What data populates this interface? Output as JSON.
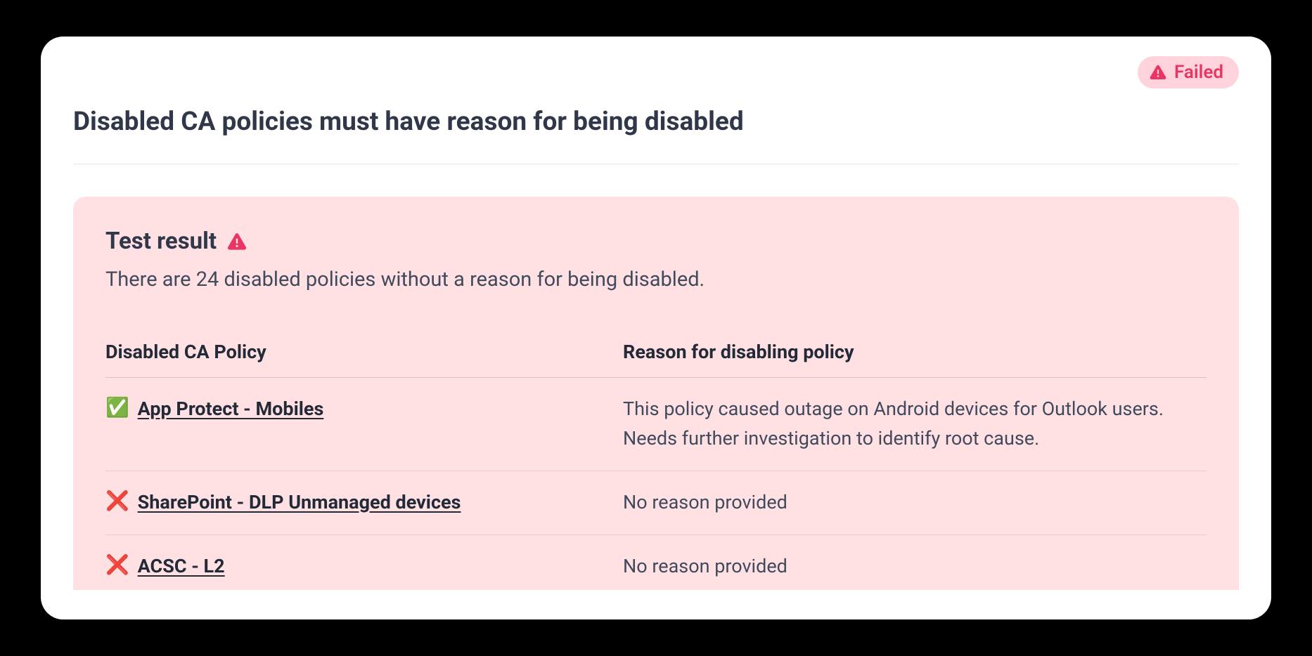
{
  "statusBadge": {
    "label": "Failed"
  },
  "title": "Disabled CA policies must have reason for being disabled",
  "resultPanel": {
    "heading": "Test result",
    "summary": "There are 24 disabled policies without a reason for being disabled."
  },
  "table": {
    "headers": {
      "policy": "Disabled CA Policy",
      "reason": "Reason for disabling policy"
    },
    "rows": [
      {
        "status": "pass",
        "statusIcon": "✅",
        "policyName": "App Protect - Mobiles",
        "reason": "This policy caused outage on Android devices for Outlook users. Needs further investigation to identify root cause."
      },
      {
        "status": "fail",
        "statusIcon": "❌",
        "policyName": "SharePoint - DLP Unmanaged devices",
        "reason": "No reason provided"
      },
      {
        "status": "fail",
        "statusIcon": "❌",
        "policyName": "ACSC - L2",
        "reason": "No reason provided"
      }
    ]
  }
}
